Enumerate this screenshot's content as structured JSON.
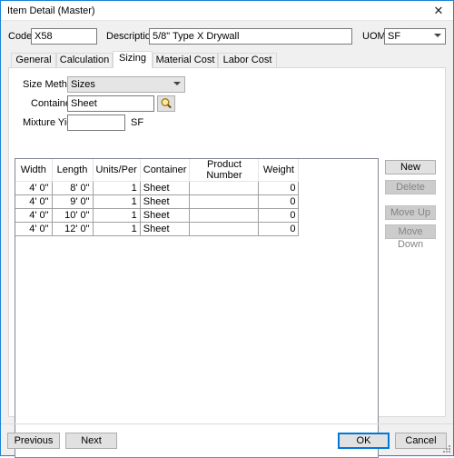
{
  "window": {
    "title": "Item Detail (Master)",
    "close_glyph": "✕"
  },
  "header": {
    "code_label": "Code",
    "code_value": "X58",
    "description_label": "Description",
    "description_value": "5/8\" Type X Drywall",
    "uom_label": "UOM",
    "uom_value": "SF"
  },
  "tabs": [
    "General",
    "Calculation",
    "Sizing",
    "Material Cost",
    "Labor Cost"
  ],
  "active_tab": "Sizing",
  "sizing": {
    "size_method_label": "Size Method",
    "size_method_value": "Sizes",
    "container_label": "Container",
    "container_value": "Sheet",
    "mixture_yield_label": "Mixture Yield",
    "mixture_yield_value": "",
    "mixture_yield_unit": "SF"
  },
  "grid": {
    "columns": [
      "Width",
      "Length",
      "Units/Per",
      "Container",
      "Product Number",
      "Weight"
    ],
    "rows": [
      [
        "4' 0\"",
        "8' 0\"",
        "1",
        "Sheet",
        "",
        "0"
      ],
      [
        "4' 0\"",
        "9' 0\"",
        "1",
        "Sheet",
        "",
        "0"
      ],
      [
        "4' 0\"",
        "10' 0\"",
        "1",
        "Sheet",
        "",
        "0"
      ],
      [
        "4' 0\"",
        "12' 0\"",
        "1",
        "Sheet",
        "",
        "0"
      ]
    ]
  },
  "side_buttons": {
    "new": "New",
    "delete": "Delete",
    "move_up": "Move Up",
    "move_down": "Move Down"
  },
  "footer": {
    "previous": "Previous",
    "next": "Next",
    "ok": "OK",
    "cancel": "Cancel"
  },
  "colors": {
    "accent": "#0078d7",
    "window_border": "#1883d7",
    "panel": "#f0f0f0"
  },
  "icons": {
    "search": "magnifier-icon",
    "close": "close-icon",
    "dropdown": "chevron-down-icon"
  }
}
